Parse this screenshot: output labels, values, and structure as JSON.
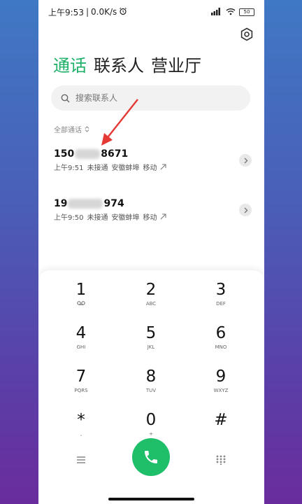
{
  "status_bar": {
    "time": "上午9:53",
    "separator": "|",
    "network_speed": "0.0K/s",
    "battery": "50"
  },
  "tabs": [
    {
      "label": "通话",
      "active": true
    },
    {
      "label": "联系人",
      "active": false
    },
    {
      "label": "营业厅",
      "active": false
    }
  ],
  "search": {
    "placeholder": "搜索联系人"
  },
  "filter": {
    "label": "全部通话"
  },
  "calls": [
    {
      "number_prefix": "150",
      "number_suffix": "8671",
      "time": "上午9:51",
      "status": "未接通",
      "location": "安徽蚌埠",
      "carrier": "移动"
    },
    {
      "number_prefix": "19",
      "number_suffix": "974",
      "time": "上午9:50",
      "status": "未接通",
      "location": "安徽蚌埠",
      "carrier": "移动"
    }
  ],
  "keypad": [
    {
      "digit": "1",
      "letters": "",
      "voicemail": true
    },
    {
      "digit": "2",
      "letters": "ABC"
    },
    {
      "digit": "3",
      "letters": "DEF"
    },
    {
      "digit": "4",
      "letters": "GHI"
    },
    {
      "digit": "5",
      "letters": "JKL"
    },
    {
      "digit": "6",
      "letters": "MNO"
    },
    {
      "digit": "7",
      "letters": "PQRS"
    },
    {
      "digit": "8",
      "letters": "TUV"
    },
    {
      "digit": "9",
      "letters": "WXYZ"
    },
    {
      "digit": "*",
      "letters": ","
    },
    {
      "digit": "0",
      "letters": "+"
    },
    {
      "digit": "#",
      "letters": ""
    }
  ],
  "colors": {
    "accent": "#1fb06a",
    "call_button": "#1fbf6a",
    "annotation": "#e53935"
  }
}
